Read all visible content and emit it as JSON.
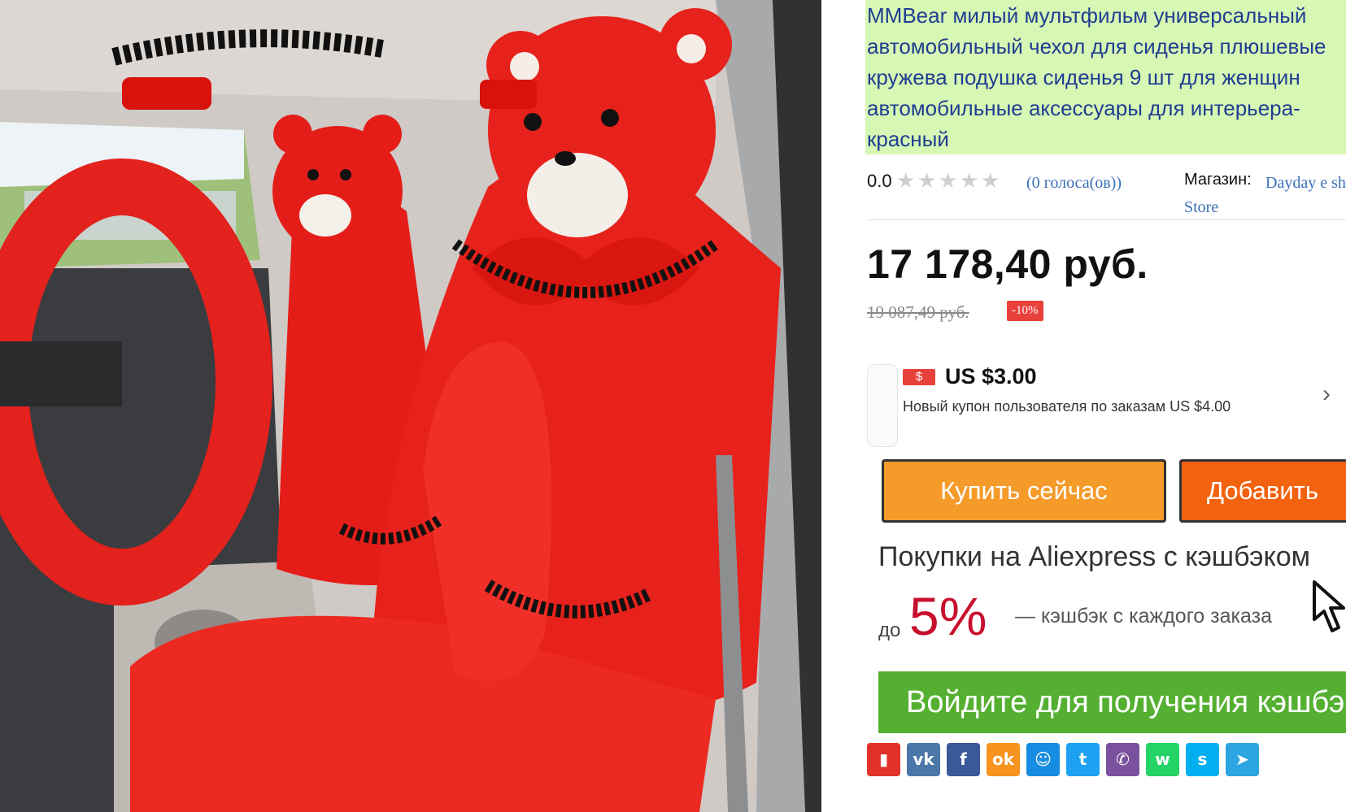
{
  "product": {
    "title": "MMBear милый мультфильм универсальный автомобильный чехол для сиденья плюшевые кружева подушка сиденья 9 шт для женщин автомобильные аксессуары для интерьера-красный",
    "image_icon": "car-seat-cover-photo"
  },
  "rating": {
    "value": "0.0",
    "stars_total": 5,
    "stars_filled": 0,
    "votes": "(0 голоса(ов))"
  },
  "store": {
    "label": "Магазин:",
    "name": "Dayday e shop Store"
  },
  "price": {
    "current": "17 178,40 руб.",
    "old": "19 087,49 руб.",
    "discount": "-10%"
  },
  "coupon": {
    "tag": "$",
    "amount": "US $3.00",
    "description": "Новый купон пользователя по заказам US $4.00"
  },
  "buttons": {
    "buy_now": "Купить сейчас",
    "add_to_cart": "Добавить"
  },
  "cashback": {
    "title": "Покупки на Aliexpress с кэшбэком",
    "upto": "до",
    "percent": "5%",
    "description": "— кэшбэк с каждого заказа",
    "login_button": "Войдите для получения кэшбэка"
  },
  "share": {
    "buttons": [
      {
        "icon": "bookmark-icon",
        "glyph": "▮",
        "color": "#e0322b"
      },
      {
        "icon": "vk-icon",
        "glyph": "vk",
        "color": "#4a76a8"
      },
      {
        "icon": "facebook-icon",
        "glyph": "f",
        "color": "#3b5998"
      },
      {
        "icon": "odnoklassniki-icon",
        "glyph": "ok",
        "color": "#f7931e"
      },
      {
        "icon": "moimir-icon",
        "glyph": "☺",
        "color": "#168de2"
      },
      {
        "icon": "twitter-icon",
        "glyph": "t",
        "color": "#1da1f2"
      },
      {
        "icon": "viber-icon",
        "glyph": "✆",
        "color": "#7b519d"
      },
      {
        "icon": "whatsapp-icon",
        "glyph": "w",
        "color": "#25d366"
      },
      {
        "icon": "skype-icon",
        "glyph": "s",
        "color": "#00aff0"
      },
      {
        "icon": "telegram-icon",
        "glyph": "➤",
        "color": "#2ca5e0"
      }
    ]
  },
  "colors": {
    "title_bg": "#d7f7b4",
    "title_text": "#1f3e91",
    "buy_button": "#f59b2a",
    "add_button": "#f2620f",
    "login_button": "#55b032",
    "cashback_red": "#c8102e",
    "discount_badge": "#e8413b"
  }
}
